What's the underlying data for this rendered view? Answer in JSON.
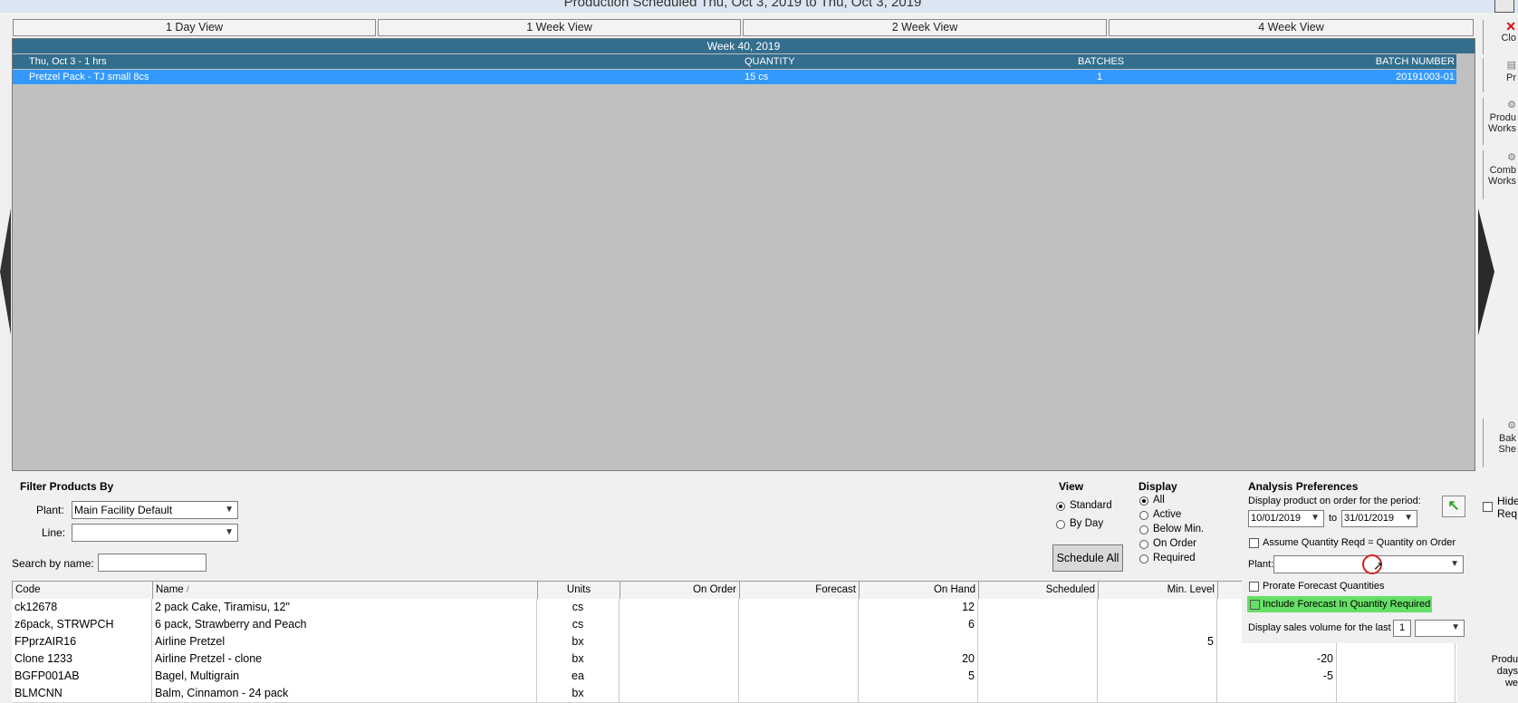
{
  "window": {
    "title": "Production Scheduled Thu, Oct 3, 2019 to Thu, Oct 3, 2019"
  },
  "views": [
    "1 Day View",
    "1 Week View",
    "2 Week View",
    "4 Week View"
  ],
  "schedule": {
    "week_label": "Week 40, 2019",
    "columns": {
      "day": "Thu, Oct 3 - 1 hrs",
      "quantity": "QUANTITY",
      "batches": "BATCHES",
      "batch_number": "BATCH NUMBER"
    },
    "row": {
      "product": "Pretzel Pack - TJ small 8cs",
      "quantity": "15 cs",
      "batches": "1",
      "batch_number": "20191003-01"
    }
  },
  "sidebar": {
    "close": "Clo",
    "print": "Pr",
    "production_worksheet": [
      "Produ",
      "Works"
    ],
    "combined_worksheet": [
      "Comb",
      "Works"
    ],
    "bake_sheet": [
      "Bak",
      "She"
    ],
    "hide_req": [
      "Hide",
      "Req"
    ],
    "footer": [
      "Produ",
      "days",
      "we"
    ]
  },
  "filter": {
    "title": "Filter Products By",
    "plant_label": "Plant:",
    "plant_value": "Main Facility Default",
    "line_label": "Line:",
    "line_value": "",
    "search_label": "Search by name:",
    "search_value": ""
  },
  "view_group": {
    "title": "View",
    "options": [
      "Standard",
      "By Day"
    ],
    "selected": "Standard"
  },
  "display_group": {
    "title": "Display",
    "options": [
      "All",
      "Active",
      "Below Min.",
      "On Order",
      "Required"
    ],
    "selected": "All"
  },
  "schedule_all_label": "Schedule All",
  "analysis": {
    "title": "Analysis Preferences",
    "period_label": "Display product on order for the period:",
    "from_date": "10/01/2019",
    "to_label": "to",
    "to_date": "31/01/2019",
    "assume_label": "Assume Quantity Reqd = Quantity on Order",
    "plant_label": "Plant:",
    "plant_value": "",
    "prorate_label": "Prorate Forecast Quantities",
    "include_label": "Include Forecast In Quantity Required",
    "sales_label": "Display sales volume for the last",
    "sales_value": "1",
    "sales_unit": "",
    "include_highlight": "#66e066"
  },
  "grid": {
    "headers": {
      "code": "Code",
      "name": "Name",
      "units": "Units",
      "on_order": "On Order",
      "forecast": "Forecast",
      "on_hand": "On Hand",
      "scheduled": "Scheduled",
      "min_level": "Min. Level"
    },
    "sort_indicator": "/",
    "rows": [
      {
        "code": "ck12678",
        "name": "2 pack Cake, Tiramisu, 12\"",
        "units": "cs",
        "on_order": "",
        "forecast": "",
        "on_hand": "12",
        "scheduled": "",
        "min_level": "",
        "required": ""
      },
      {
        "code": "z6pack, STRWPCH",
        "name": "6 pack, Strawberry and Peach",
        "units": "cs",
        "on_order": "",
        "forecast": "",
        "on_hand": "6",
        "scheduled": "",
        "min_level": "",
        "required": ""
      },
      {
        "code": "FPprzAIR16",
        "name": "Airline Pretzel",
        "units": "bx",
        "on_order": "",
        "forecast": "",
        "on_hand": "",
        "scheduled": "",
        "min_level": "5",
        "required": ""
      },
      {
        "code": "Clone 1233",
        "name": "Airline Pretzel - clone",
        "units": "bx",
        "on_order": "",
        "forecast": "",
        "on_hand": "20",
        "scheduled": "",
        "min_level": "",
        "required": "-20"
      },
      {
        "code": "BGFP001AB",
        "name": "Bagel, Multigrain",
        "units": "ea",
        "on_order": "",
        "forecast": "",
        "on_hand": "5",
        "scheduled": "",
        "min_level": "",
        "required": "-5"
      },
      {
        "code": "BLMCNN",
        "name": "Balm, Cinnamon - 24 pack",
        "units": "bx",
        "on_order": "",
        "forecast": "",
        "on_hand": "",
        "scheduled": "",
        "min_level": "",
        "required": ""
      }
    ]
  }
}
